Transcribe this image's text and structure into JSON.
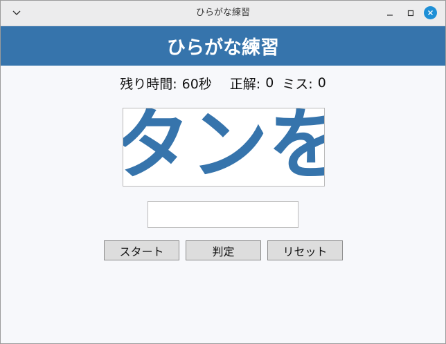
{
  "window": {
    "title": "ひらがな練習",
    "icons": [
      "chevron-down-icon",
      "minimize-icon",
      "maximize-icon",
      "close-icon"
    ],
    "close_color": "#1e8fd6"
  },
  "header": {
    "title": "ひらがな練習",
    "color": "#3674ac"
  },
  "stats": {
    "time_label": "残り時間:",
    "time_value": "60秒",
    "correct_label": "正解:",
    "correct_value": "0",
    "miss_label": "ミス:",
    "miss_value": "0"
  },
  "display": {
    "text": "タンを押"
  },
  "answer": {
    "value": "",
    "placeholder": ""
  },
  "buttons": {
    "start": "スタート",
    "check": "判定",
    "reset": "リセット"
  }
}
